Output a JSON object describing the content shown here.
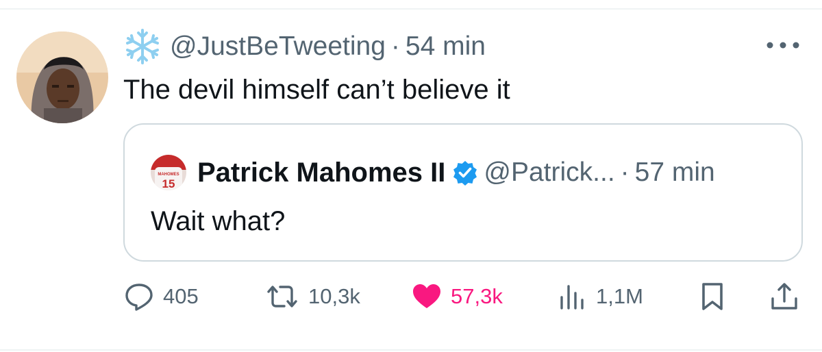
{
  "tweet": {
    "author_handle": "@JustBeTweeting",
    "separator": "·",
    "time": "54 min",
    "text": "The devil himself can’t believe it",
    "header_icon": "snowflake-icon"
  },
  "quoted_tweet": {
    "author_name": "Patrick Mahomes II",
    "author_handle": "@Patrick...",
    "separator": "·",
    "time": "57 min",
    "text": "Wait what?",
    "verified": true,
    "avatar_jersey_number": "15",
    "avatar_jersey_name": "MAHOMES"
  },
  "actions": {
    "replies": "405",
    "retweets": "10,3k",
    "likes": "57,3k",
    "views": "1,1M"
  },
  "colors": {
    "text_primary": "#0f1419",
    "text_secondary": "#536471",
    "like_active": "#f91880",
    "verified_blue": "#1d9bf0",
    "border": "#cfd9de"
  }
}
